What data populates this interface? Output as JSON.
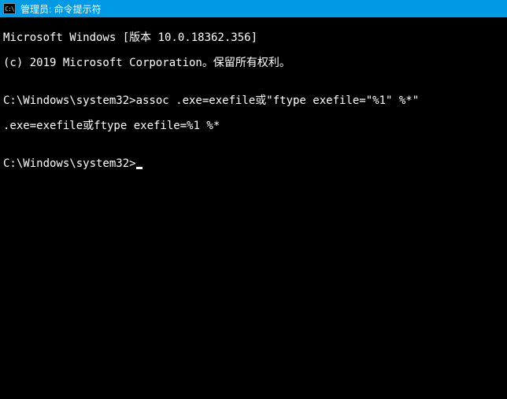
{
  "titlebar": {
    "icon_text": "C:\\",
    "title": "管理员: 命令提示符"
  },
  "terminal": {
    "lines": [
      "Microsoft Windows [版本 10.0.18362.356]",
      "(c) 2019 Microsoft Corporation。保留所有权利。",
      "",
      "C:\\Windows\\system32>assoc .exe=exefile或\"ftype exefile=\"%1\" %*\"",
      ".exe=exefile或ftype exefile=%1 %*",
      "",
      "C:\\Windows\\system32>"
    ]
  }
}
